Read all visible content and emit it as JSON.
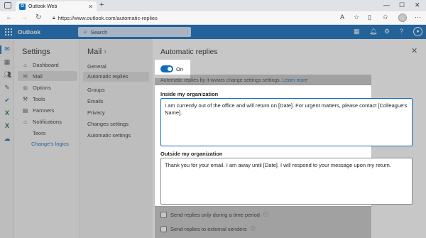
{
  "browser": {
    "tab_title": "Outlook Web",
    "url": "https://www.outlook.com/automatic-replies"
  },
  "header": {
    "app_name": "Outlook",
    "search_placeholder": "Search"
  },
  "settings": {
    "title": "Settings",
    "items": [
      {
        "label": "Dashboard",
        "icon": "dashboard-icon"
      },
      {
        "label": "Mail",
        "icon": "mail-icon"
      },
      {
        "label": "Options",
        "icon": "options-icon"
      },
      {
        "label": "Tools",
        "icon": "tools-icon"
      },
      {
        "label": "Parnners",
        "icon": "partners-icon"
      },
      {
        "label": "Notifications",
        "icon": "bell-icon"
      },
      {
        "label": "Teors",
        "icon": ""
      }
    ],
    "link": "Change's logics"
  },
  "mail": {
    "title": "Mail",
    "items": [
      "General",
      "Automatic replies",
      "Groups",
      "Emails",
      "Privacy",
      "Changes settings",
      "Automatic settings"
    ]
  },
  "pane": {
    "title": "Automatic replies",
    "toggle_label": "On",
    "toggle_on": true,
    "description": "Automatic replies by it-wwars change settings settings.",
    "learn_more": "Learn more",
    "inside_title": "Inside my organization",
    "inside_text": "I am currently out of the office and will return on [Date]. For urgent matters, please contact [Colleague's Name].",
    "outside_title": "Outside my organization",
    "outside_text": "Thank you for your email. I am away until [Date]. I will respond to your message upon my return.",
    "check1": "Send replies only during a time period",
    "check2": "Send replies to external senders"
  },
  "colors": {
    "accent": "#0f6cbd",
    "search_bg": "#cfe4fa"
  }
}
